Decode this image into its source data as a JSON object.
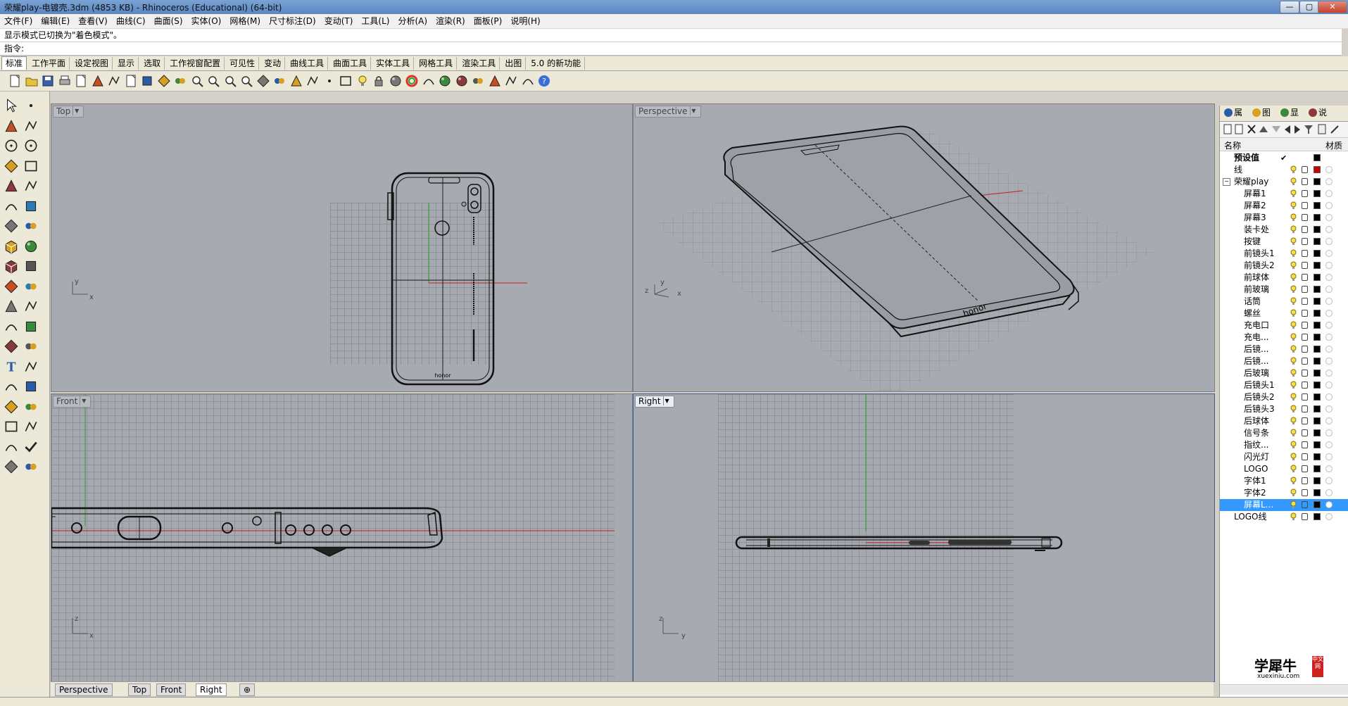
{
  "window": {
    "title": "荣耀play-电镀壳.3dm (4853 KB) - Rhinoceros (Educational) (64-bit)",
    "minimize": "—",
    "maximize": "▢",
    "close": "✕"
  },
  "menubar": [
    "文件(F)",
    "编辑(E)",
    "查看(V)",
    "曲线(C)",
    "曲面(S)",
    "实体(O)",
    "网格(M)",
    "尺寸标注(D)",
    "变动(T)",
    "工具(L)",
    "分析(A)",
    "渲染(R)",
    "面板(P)",
    "说明(H)"
  ],
  "command": {
    "message": "显示模式已切换为\"着色模式\"。",
    "prompt": "指令:",
    "value": ""
  },
  "toolbar_tabs": [
    "标准",
    "工作平面",
    "设定视图",
    "显示",
    "选取",
    "工作视窗配置",
    "可见性",
    "变动",
    "曲线工具",
    "曲面工具",
    "实体工具",
    "网格工具",
    "渲染工具",
    "出图",
    "5.0 的新功能"
  ],
  "toolbar_active_tab": "标准",
  "viewports": {
    "top": {
      "label": "Top",
      "axis_y": "y",
      "axis_x": "x"
    },
    "perspective": {
      "label": "Perspective",
      "axis_z": "z",
      "axis_y": "y",
      "axis_x": "x"
    },
    "front": {
      "label": "Front",
      "axis_z": "z",
      "axis_x": "x"
    },
    "right": {
      "label": "Right",
      "axis_z": "z",
      "axis_y": "y"
    }
  },
  "phone_brand": "honor",
  "viewport_tabs": [
    "Perspective",
    "Top",
    "Front",
    "Right"
  ],
  "viewport_active_tab": "Right",
  "viewport_tab_add": "⊕",
  "right_panel": {
    "tabs": [
      "属",
      "图",
      "显",
      "说"
    ],
    "headers": {
      "name": "名称",
      "material": "材质"
    },
    "layers": [
      {
        "name": "预设值",
        "indent": 0,
        "bold": true,
        "current": true,
        "color": "#000000"
      },
      {
        "name": "线",
        "indent": 0,
        "color": "#cc0000"
      },
      {
        "name": "荣耀play",
        "indent": 0,
        "expand": true,
        "color": "#000000"
      },
      {
        "name": "屏幕1",
        "indent": 1,
        "color": "#000000"
      },
      {
        "name": "屏幕2",
        "indent": 1,
        "color": "#000000"
      },
      {
        "name": "屏幕3",
        "indent": 1,
        "color": "#000000"
      },
      {
        "name": "装卡处",
        "indent": 1,
        "color": "#000000"
      },
      {
        "name": "按键",
        "indent": 1,
        "color": "#000000"
      },
      {
        "name": "前镜头1",
        "indent": 1,
        "color": "#000000"
      },
      {
        "name": "前镜头2",
        "indent": 1,
        "color": "#000000"
      },
      {
        "name": "前球体",
        "indent": 1,
        "color": "#000000"
      },
      {
        "name": "前玻璃",
        "indent": 1,
        "color": "#000000"
      },
      {
        "name": "话筒",
        "indent": 1,
        "color": "#000000"
      },
      {
        "name": "螺丝",
        "indent": 1,
        "color": "#000000"
      },
      {
        "name": "充电口",
        "indent": 1,
        "color": "#000000"
      },
      {
        "name": "充电...",
        "indent": 1,
        "color": "#000000"
      },
      {
        "name": "后镜...",
        "indent": 1,
        "color": "#000000"
      },
      {
        "name": "后镜...",
        "indent": 1,
        "color": "#000000"
      },
      {
        "name": "后玻璃",
        "indent": 1,
        "color": "#000000"
      },
      {
        "name": "后镜头1",
        "indent": 1,
        "color": "#000000"
      },
      {
        "name": "后镜头2",
        "indent": 1,
        "color": "#000000"
      },
      {
        "name": "后镜头3",
        "indent": 1,
        "color": "#000000"
      },
      {
        "name": "后球体",
        "indent": 1,
        "color": "#000000"
      },
      {
        "name": "信号条",
        "indent": 1,
        "color": "#000000"
      },
      {
        "name": "指纹...",
        "indent": 1,
        "color": "#000000"
      },
      {
        "name": "闪光灯",
        "indent": 1,
        "color": "#000000"
      },
      {
        "name": "LOGO",
        "indent": 1,
        "color": "#000000"
      },
      {
        "name": "字体1",
        "indent": 1,
        "color": "#000000"
      },
      {
        "name": "字体2",
        "indent": 1,
        "color": "#000000"
      },
      {
        "name": "屏幕L...",
        "indent": 1,
        "selected": true,
        "color": "#000000"
      },
      {
        "name": "LOGO线",
        "indent": 0,
        "color": "#000000"
      }
    ]
  },
  "watermark": {
    "brand": "学犀牛",
    "url": "xuexiniu.com",
    "badge": "中文网"
  },
  "icons": {
    "toolbar": [
      "new-file-icon",
      "open-folder-icon",
      "save-icon",
      "print-icon",
      "import-icon",
      "cut-icon",
      "copy-icon",
      "paste-icon",
      "undo-icon",
      "pan-icon",
      "rotate-view-icon",
      "zoom-icon",
      "zoom-window-icon",
      "zoom-extents-icon",
      "zoom-selected-icon",
      "rotate-icon",
      "four-viewports-icon",
      "car-icon",
      "render-icon",
      "point-icon",
      "grid-icon",
      "light-icon",
      "lock-icon",
      "shaded-sphere-icon",
      "color-wheel-icon",
      "material-icon",
      "sphere-icon",
      "texture-sphere-icon",
      "environment-icon",
      "tools-icon",
      "gear-icon",
      "snap-icon",
      "help-icon"
    ],
    "left": [
      "select-icon",
      "point-icon",
      "polyline-icon",
      "curve-icon",
      "circle-icon",
      "ellipse-icon",
      "polygon-icon",
      "rectangle-icon",
      "arc-icon",
      "free-curve-icon",
      "fillet-icon",
      "offset-icon",
      "surface-icon",
      "revolve-icon",
      "box-solid-icon",
      "sphere-solid-icon",
      "cylinder-icon",
      "extrude-icon",
      "boolean-icon",
      "explode-icon",
      "trim-icon",
      "split-icon",
      "join-icon",
      "group-icon",
      "move-icon",
      "scale-icon",
      "text-icon",
      "dimension-icon",
      "array-icon",
      "mirror-icon",
      "mesh-icon",
      "mesh-tools-icon",
      "grid-array-icon",
      "analysis-icon",
      "layer-icon",
      "check-icon",
      "render-preview-icon",
      "materials-icon"
    ]
  }
}
